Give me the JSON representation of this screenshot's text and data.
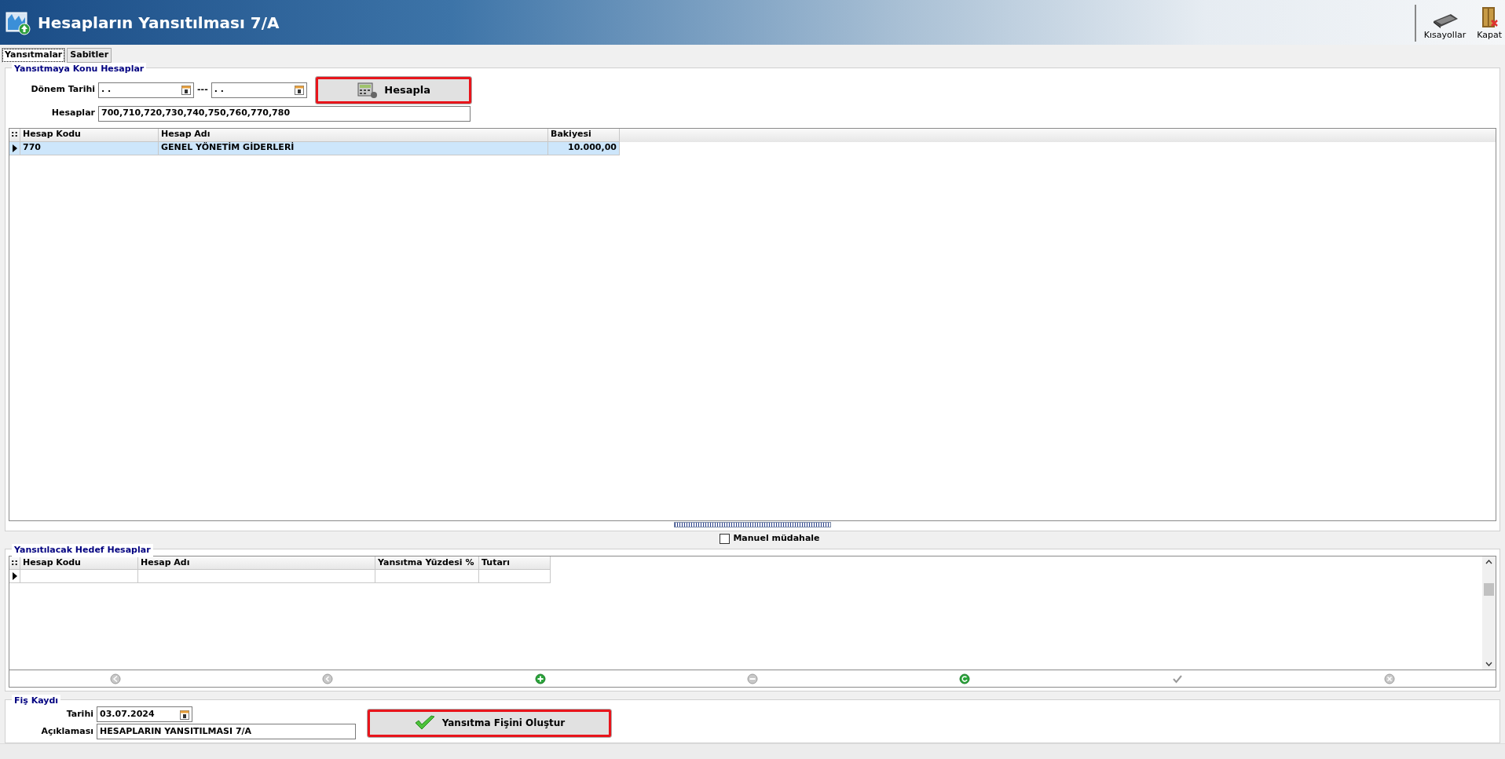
{
  "window": {
    "title": "Hesapların Yansıtılması 7/A"
  },
  "toolbar": [
    {
      "label": "Kısayollar",
      "kind": "keyboard"
    },
    {
      "label": "Kapat",
      "kind": "door"
    }
  ],
  "tabs": [
    {
      "label": "Yansıtmalar",
      "selected": true
    },
    {
      "label": "Sabitler",
      "selected": false
    }
  ],
  "source": {
    "title": "Yansıtmaya Konu Hesaplar",
    "period_label": "Dönem Tarihi",
    "date_from": ". .",
    "separator": "---",
    "date_to": ". .",
    "calc_button": {
      "label": "Hesapla",
      "highlighted": true
    },
    "accounts_label": "Hesaplar",
    "accounts": "700,710,720,730,740,750,760,770,780",
    "table": {
      "corner": "::",
      "columns": [
        {
          "label": "Hesap Kodu",
          "kind": "text"
        },
        {
          "label": "Hesap Adı",
          "kind": "text"
        },
        {
          "label": "Bakiyesi",
          "kind": "amount"
        }
      ],
      "rows": [
        {
          "cells": [
            "770",
            "GENEL YÖNETİM GİDERLERİ",
            "10.000,00"
          ],
          "selected": true
        }
      ]
    }
  },
  "manual": {
    "label": "Manuel müdahale",
    "checked": false
  },
  "target": {
    "title": "Yansıtılacak Hedef Hesaplar",
    "table": {
      "corner": "::",
      "columns": [
        {
          "label": "Hesap Kodu"
        },
        {
          "label": "Hesap Adı"
        },
        {
          "label": "Yansıtma Yüzdesi %"
        },
        {
          "label": "Tutarı"
        }
      ]
    }
  },
  "navigator": [
    {
      "kind": "first",
      "enabled": false
    },
    {
      "kind": "prior",
      "enabled": false
    },
    {
      "kind": "insert",
      "enabled": true
    },
    {
      "kind": "delete",
      "enabled": false
    },
    {
      "kind": "refresh",
      "enabled": true
    },
    {
      "kind": "post",
      "enabled": false
    },
    {
      "kind": "cancel",
      "enabled": false
    }
  ],
  "receipt": {
    "title": "Fiş Kaydı",
    "date_label": "Tarihi",
    "date": "03.07.2024",
    "desc_label": "Açıklaması",
    "desc": "HESAPLARIN YANSITILMASI 7/A",
    "button": {
      "label": "Yansıtma Fişini Oluştur",
      "highlighted": true
    }
  }
}
